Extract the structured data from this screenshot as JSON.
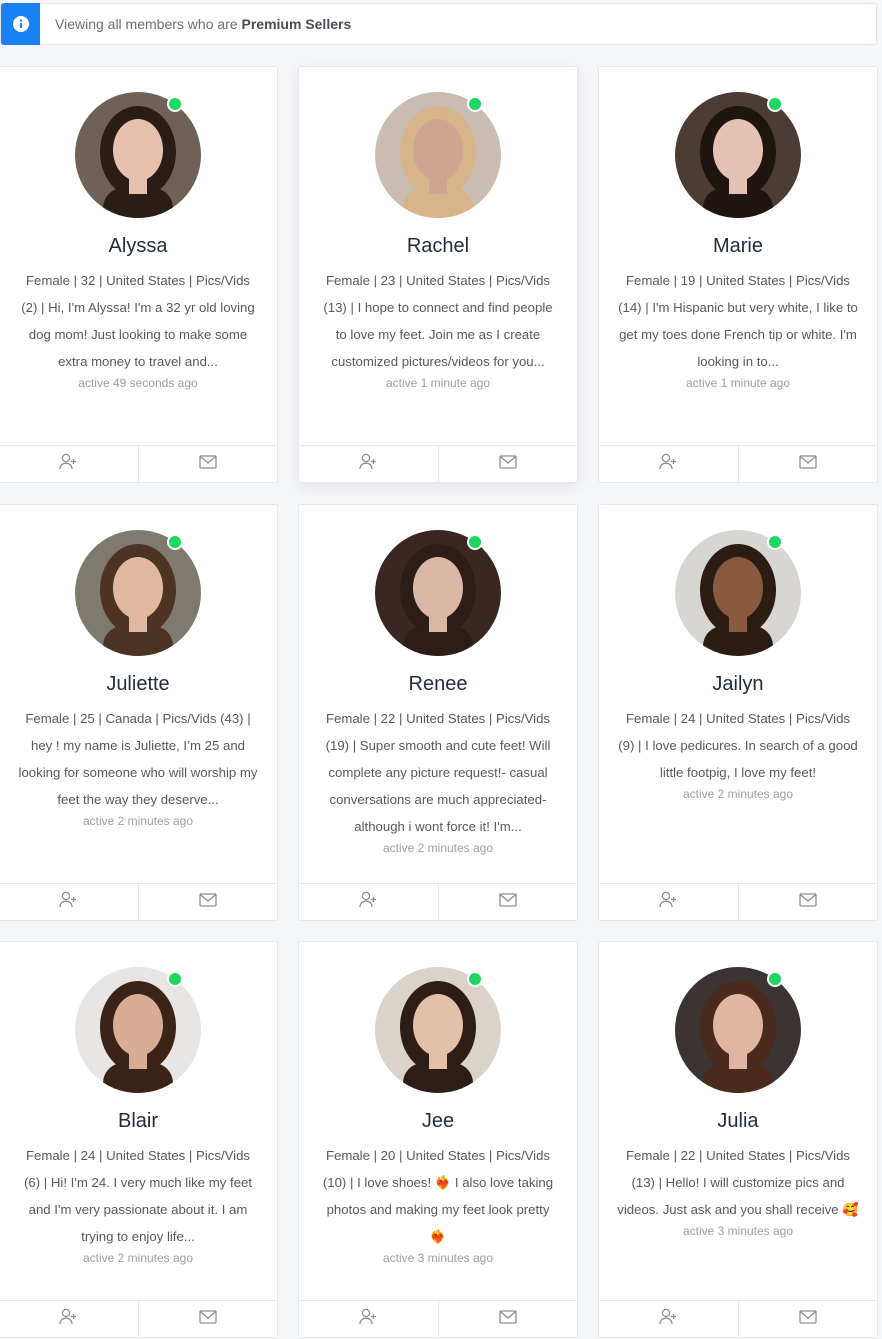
{
  "info": {
    "prefix": "Viewing all members who are",
    "highlight": "Premium Sellers"
  },
  "members": [
    {
      "name": "Alyssa",
      "bio": "Female | 32 | United States | Pics/Vids (2) | Hi, I'm Alyssa! I'm a 32 yr old loving dog mom! Just looking to make some extra money to travel and...",
      "active": "active 49 seconds ago",
      "colors": {
        "bg": "#6e6258",
        "hair": "#2a1d18",
        "skin": "#e7c1ad"
      }
    },
    {
      "name": "Rachel",
      "bio": "Female | 23 | United States | Pics/Vids (13) | I hope to connect and find people to love my feet. Join me as I create customized pictures/videos for you...",
      "active": "active 1 minute ago",
      "colors": {
        "bg": "#c9bdb3",
        "hair": "#d7b48a",
        "skin": "#cfa58f"
      }
    },
    {
      "name": "Marie",
      "bio": "Female | 19 | United States | Pics/Vids (14) | I'm Hispanic but very white, I like to get my toes done French tip or white. I'm looking in to...",
      "active": "active 1 minute ago",
      "colors": {
        "bg": "#4b3d35",
        "hair": "#1e1511",
        "skin": "#e5c2b1"
      }
    },
    {
      "name": "Juliette",
      "bio": "Female | 25 | Canada | Pics/Vids (43) | hey ! my name is Juliette, I’m 25 and looking for someone who will worship my feet the way they deserve...",
      "active": "active 2 minutes ago",
      "colors": {
        "bg": "#7e7a70",
        "hair": "#4c3322",
        "skin": "#e0b8a0"
      }
    },
    {
      "name": "Renee",
      "bio": "Female | 22 | United States | Pics/Vids (19) | Super smooth and cute feet! Will complete any picture request!- casual conversations are much appreciated- although i wont force it! I'm...",
      "active": "active 2 minutes ago",
      "colors": {
        "bg": "#3a2622",
        "hair": "#2d1d19",
        "skin": "#ddb7a6"
      }
    },
    {
      "name": "Jailyn",
      "bio": "Female | 24 | United States | Pics/Vids (9) | I love pedicures. In search of a good little footpig, I love my feet!",
      "active": "active 2 minutes ago",
      "colors": {
        "bg": "#d8d6d2",
        "hair": "#2b1c14",
        "skin": "#8a5a3e"
      }
    },
    {
      "name": "Blair",
      "bio": "Female | 24 | United States | Pics/Vids (6) | Hi! I'm 24. I very much like my feet and I'm very passionate about it.  I am trying to enjoy life...",
      "active": "active 2 minutes ago",
      "colors": {
        "bg": "#e8e6e4",
        "hair": "#3a2418",
        "skin": "#d9ad94"
      }
    },
    {
      "name": "Jee",
      "bio": "Female | 20 | United States | Pics/Vids (10) | I love shoes! ❤️‍🔥 I also love taking photos and making my feet look pretty ❤️‍🔥",
      "active": "active 3 minutes ago",
      "colors": {
        "bg": "#d9d3cb",
        "hair": "#2c1d16",
        "skin": "#e3c0a8"
      }
    },
    {
      "name": "Julia",
      "bio": "Female | 22 | United States | Pics/Vids (13) | Hello! I will customize pics and videos. Just ask and you shall receive 🥰",
      "active": "active 3 minutes ago",
      "colors": {
        "bg": "#3b3432",
        "hair": "#4a2a1d",
        "skin": "#e1b6a0"
      }
    }
  ]
}
